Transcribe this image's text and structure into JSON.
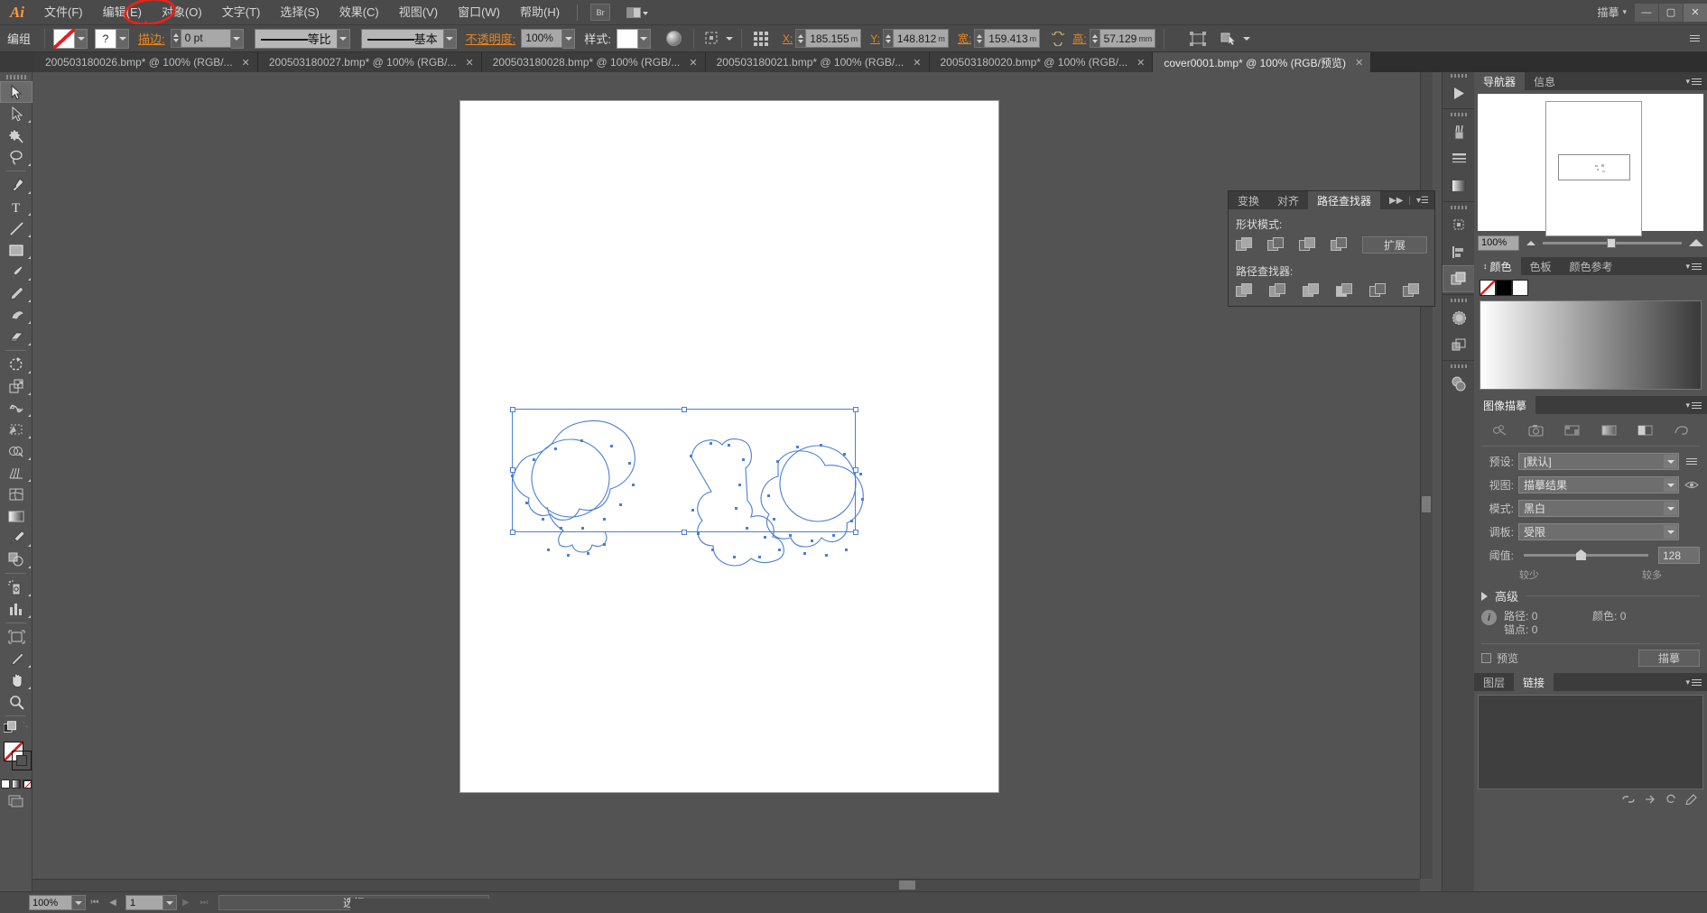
{
  "app": {
    "name": "Ai",
    "menus": [
      "文件(F)",
      "编辑(E)",
      "对象(O)",
      "文字(T)",
      "选择(S)",
      "效果(C)",
      "视图(V)",
      "窗口(W)",
      "帮助(H)"
    ],
    "bridge_button": "Br",
    "workspace_label": "描摹",
    "window_controls": {
      "minimize": "—",
      "maximize": "▢",
      "close": "✕"
    }
  },
  "options_bar": {
    "selection_type": "编组",
    "fill_swatch": "none",
    "stroke_swatch": "?",
    "stroke_label": "描边:",
    "stroke_weight": "0 pt",
    "variable_width_profile": "等比",
    "brush_definition": "基本",
    "opacity_label": "不透明度:",
    "opacity_value": "100%",
    "style_label": "样式:",
    "transform": {
      "x_label": "X:",
      "x_value": "185.155",
      "x_unit": "m",
      "y_label": "Y:",
      "y_value": "148.812",
      "y_unit": "m",
      "w_label": "宽:",
      "w_value": "159.413",
      "w_unit": "m",
      "h_label": "高:",
      "h_value": "57.129",
      "h_unit": "mm"
    }
  },
  "tabs": [
    {
      "title": "200503180026.bmp* @ 100% (RGB/...",
      "close": "✕",
      "active": false
    },
    {
      "title": "200503180027.bmp* @ 100% (RGB/...",
      "close": "✕",
      "active": false
    },
    {
      "title": "200503180028.bmp* @ 100% (RGB/...",
      "close": "✕",
      "active": false
    },
    {
      "title": "200503180021.bmp* @ 100% (RGB/...",
      "close": "✕",
      "active": false
    },
    {
      "title": "200503180020.bmp* @ 100% (RGB/...",
      "close": "✕",
      "active": false
    },
    {
      "title": "cover0001.bmp* @ 100% (RGB/预览)",
      "close": "✕",
      "active": true
    }
  ],
  "pathfinder_panel": {
    "tabs": [
      "变换",
      "对齐",
      "路径查找器"
    ],
    "active_tab": "路径查找器",
    "shape_modes_label": "形状模式:",
    "expand_button": "扩展",
    "pathfinders_label": "路径查找器:",
    "shape_mode_buttons": [
      "unite-icon",
      "minus-front-icon",
      "intersect-icon",
      "exclude-icon"
    ],
    "pathfinder_buttons": [
      "divide-icon",
      "trim-icon",
      "merge-icon",
      "crop-icon",
      "outline-icon",
      "minus-back-icon"
    ]
  },
  "navigator_panel": {
    "tabs": [
      "导航器",
      "信息"
    ],
    "active_tab": "导航器",
    "zoom_value": "100%"
  },
  "color_panel": {
    "tabs": [
      "颜色",
      "色板",
      "颜色参考"
    ],
    "active_tab": "颜色"
  },
  "image_trace_panel": {
    "tabs": [
      "图像描摹"
    ],
    "active_tab": "图像描摹",
    "preset_label": "预设:",
    "preset_value": "[默认]",
    "view_label": "视图:",
    "view_value": "描摹结果",
    "mode_label": "模式:",
    "mode_value": "黑白",
    "palette_label": "调板:",
    "palette_value": "受限",
    "threshold_label": "阈值:",
    "threshold_value": "128",
    "threshold_min_label": "较少",
    "threshold_max_label": "较多",
    "advanced_label": "高级",
    "stats": {
      "paths_label": "路径:",
      "paths_value": "0",
      "colors_label": "颜色:",
      "colors_value": "0",
      "anchors_label": "锚点:",
      "anchors_value": "0"
    },
    "preview_label": "预览",
    "trace_button": "描摹"
  },
  "layers_panel": {
    "tabs": [
      "图层",
      "链接"
    ],
    "active_tab": "链接"
  },
  "status_bar": {
    "zoom": "100%",
    "page": "1",
    "status_text": "选择"
  },
  "toolbar": {
    "tools": [
      "selection-tool-icon",
      "direct-selection-tool-icon",
      "magic-wand-tool-icon",
      "lasso-tool-icon",
      "pen-tool-icon",
      "type-tool-icon",
      "line-segment-tool-icon",
      "rectangle-tool-icon",
      "paintbrush-tool-icon",
      "pencil-tool-icon",
      "blob-brush-tool-icon",
      "eraser-tool-icon",
      "rotate-tool-icon",
      "scale-tool-icon",
      "width-tool-icon",
      "free-transform-tool-icon",
      "shape-builder-tool-icon",
      "perspective-grid-tool-icon",
      "mesh-tool-icon",
      "gradient-tool-icon",
      "eyedropper-tool-icon",
      "blend-tool-icon",
      "symbol-sprayer-tool-icon",
      "column-graph-tool-icon",
      "artboard-tool-icon",
      "slice-tool-icon",
      "hand-tool-icon",
      "zoom-tool-icon"
    ],
    "selected_tool": "selection-tool-icon"
  },
  "right_dock": {
    "buttons": [
      "expand-panels-icon",
      "brushes-icon",
      "stroke-icon",
      "gradient-icon",
      "artboards-icon",
      "align-icon",
      "pathfinder-icon",
      "transparency-icon",
      "appearance-icon",
      "graphic-styles-icon"
    ],
    "selected": "pathfinder-icon"
  },
  "annotation": {
    "shape": "red-circle-highlight",
    "target_menu": "对象(O)",
    "color": "#e8221a"
  },
  "colors": {
    "chrome": "#535353",
    "chrome_dark": "#4a4a4a",
    "accent_orange": "#e8861e",
    "selection_blue": "#4a7fd4",
    "canvas": "#ffffff"
  }
}
